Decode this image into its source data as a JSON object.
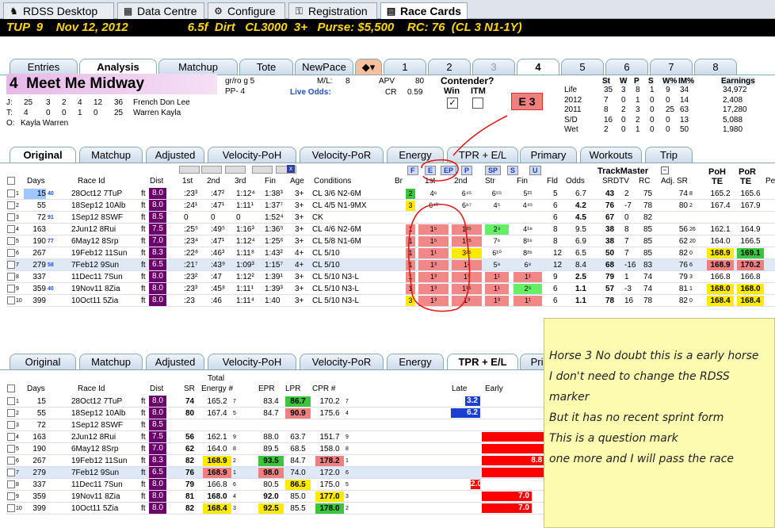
{
  "app_tabs": [
    {
      "label": "RDSS Desktop",
      "icon": "horse-icon"
    },
    {
      "label": "Data Centre",
      "icon": "grid-icon"
    },
    {
      "label": "Configure",
      "icon": "gear-icon"
    },
    {
      "label": "Registration",
      "icon": "key-icon"
    },
    {
      "label": "Race Cards",
      "icon": "card-icon"
    }
  ],
  "race_header": "TUP  9    Nov 12, 2012                  6.5f  Dirt   CL3000  3+   Purse: $5,500    RC: 76  (CL 3 N1-1Y)",
  "horse_tabs": [
    "Entries",
    "Analysis",
    "Matchup",
    "Tote",
    "NewPace",
    "1",
    "2",
    "3",
    "4",
    "5",
    "6",
    "7",
    "8"
  ],
  "horse": {
    "number": "4",
    "name": "Meet Me Midway",
    "sex": "gr/ro g 5",
    "pp": "PP- 4",
    "ml_label": "M/L:",
    "ml": "8",
    "apv_label": "APV",
    "apv": "80",
    "cr_label": "CR",
    "cr": "0.59",
    "live_odds": "Live Odds:",
    "contender": "Contender?",
    "win": "Win",
    "itm": "ITM",
    "pace_badge": "E 3"
  },
  "connections": [
    {
      "code": "J:",
      "stats": [
        "25",
        "3",
        "2",
        "4",
        "12",
        "36"
      ],
      "name": "French Don Lee"
    },
    {
      "code": "T:",
      "stats": [
        "4",
        "0",
        "0",
        "1",
        "0",
        "25"
      ],
      "name": "Warren Kayla"
    },
    {
      "code": "O:",
      "stats": [],
      "name": "Kayla Warren"
    }
  ],
  "record": {
    "headers": [
      "St",
      "W",
      "P",
      "S",
      "W%",
      "IM%",
      "Earnings"
    ],
    "rows": [
      [
        "Life",
        "35",
        "3",
        "8",
        "1",
        "9",
        "34",
        "34,972"
      ],
      [
        "2012",
        "7",
        "0",
        "1",
        "0",
        "0",
        "14",
        "2,408"
      ],
      [
        "2011",
        "8",
        "2",
        "3",
        "0",
        "25",
        "63",
        "17,280"
      ],
      [
        "S/D",
        "16",
        "0",
        "2",
        "0",
        "0",
        "13",
        "5,088"
      ],
      [
        "Wet",
        "2",
        "0",
        "1",
        "0",
        "0",
        "50",
        "1,980"
      ]
    ]
  },
  "view_tabs": [
    "Original",
    "Matchup",
    "Adjusted",
    "Velocity-PoH",
    "Velocity-PoR",
    "Energy",
    "TPR + E/L",
    "Primary",
    "Workouts",
    "Trip"
  ],
  "pace_buttons": [
    "F",
    "E",
    "EP",
    "P",
    "SP",
    "S",
    "U"
  ],
  "trackmaster": "TrackMaster",
  "top_headers": {
    "days": "Days",
    "race_id": "Race Id",
    "dist": "Dist",
    "c1": "1st",
    "c2": "2nd",
    "c3": "3rd",
    "fin": "Fin",
    "age": "Age",
    "cond": "Conditions",
    "br": "Br",
    "f1": "1st",
    "f2": "2nd",
    "str": "Str",
    "ffin": "Fin",
    "fld": "Fld",
    "odds": "Odds",
    "srdtv": "SRDTV",
    "rc": "RC",
    "adjsr": "Adj. SR",
    "poh": "PoH",
    "por": "PoR",
    "pe": "Pe",
    "te1": "TE",
    "te2": "TE"
  },
  "past": [
    {
      "n": "1",
      "days": "15",
      "d2": "40",
      "race": "28Oct12 7TuP",
      "s": "ft",
      "dist": "8.0",
      "c1": ":23³",
      "c2": ":47²",
      "c3": "1:12⁴",
      "fin": "1:38³",
      "age": "3+",
      "cond": "CL 3/6 N2-6M",
      "br": "2",
      "p1": "4⁶",
      "p2": "6⁴⁵",
      "str": "6⁵⁵",
      "pf": "5²¹",
      "fld": "5",
      "odds": "6.7",
      "sr": "43",
      "dtv": "2",
      "rc": "75",
      "adj": "74",
      "adjs": "8",
      "poh": "165.2",
      "por": "165.6"
    },
    {
      "n": "2",
      "days": "55",
      "d2": "",
      "race": "18Sep12 10Alb",
      "s": "ft",
      "dist": "8.0",
      "c1": ":24¹",
      "c2": ":47¹",
      "c3": "1:11¹",
      "fin": "1:37⁷",
      "age": "3+",
      "cond": "CL 4/5 N1-9MX",
      "br": "3",
      "p1": "6⁴³",
      "p2": "6⁶⁷",
      "str": "4⁵",
      "pf": "4⁴⁵",
      "fld": "6",
      "odds": "4.2",
      "sr": "76",
      "dtv": "-7",
      "rc": "78",
      "adj": "80",
      "adjs": "2",
      "poh": "167.4",
      "por": "167.9"
    },
    {
      "n": "3",
      "days": "72",
      "d2": "91",
      "race": "1Sep12 8SWF",
      "s": "ft",
      "dist": "8.5",
      "c1": "0",
      "c2": "0",
      "c3": "0",
      "fin": "1:52⁴",
      "age": "3+",
      "cond": "CK",
      "br": "",
      "p1": "",
      "p2": "",
      "str": "",
      "pf": "",
      "fld": "6",
      "odds": "4.5",
      "sr": "67",
      "dtv": "0",
      "rc": "82",
      "adj": "",
      "adjs": "",
      "poh": "",
      "por": ""
    },
    {
      "n": "4",
      "days": "163",
      "d2": "",
      "race": "2Jun12 8Rui",
      "s": "ft",
      "dist": "7.5",
      "c1": ":25⁵",
      "c2": ":49⁵",
      "c3": "1:16³",
      "fin": "1:36⁵",
      "age": "3+",
      "cond": "CL 4/6 N2-6M",
      "br": "1",
      "p1": "1⁵",
      "p2": "1²⁵",
      "str": "2⁴",
      "pf": "4¹⁸",
      "fld": "8",
      "odds": "9.5",
      "sr": "38",
      "dtv": "8",
      "rc": "85",
      "adj": "56",
      "adjs": "26",
      "poh": "162.1",
      "por": "164.9"
    },
    {
      "n": "5",
      "days": "190",
      "d2": "77",
      "race": "6May12 8Srp",
      "s": "ft",
      "dist": "7.0",
      "c1": ":23⁴",
      "c2": ":47¹",
      "c3": "1:12⁴",
      "fin": "1:25⁶",
      "age": "3+",
      "cond": "CL 5/8 N1-6M",
      "br": "1",
      "p1": "1⁵",
      "p2": "1²⁵",
      "str": "7⁶",
      "pf": "8¹⁶",
      "fld": "8",
      "odds": "6.9",
      "sr": "38",
      "dtv": "7",
      "rc": "85",
      "adj": "62",
      "adjs": "20",
      "poh": "164.0",
      "por": "166.5"
    },
    {
      "n": "6",
      "days": "267",
      "d2": "",
      "race": "19Feb12 11Sun",
      "s": "ft",
      "dist": "8.3",
      "c1": ":22⁸",
      "c2": ":46³",
      "c3": "1:11⁸",
      "fin": "1:43²",
      "age": "4+",
      "cond": "CL 5/10",
      "br": "1",
      "p1": "1¹",
      "p2": "3²⁵",
      "str": "6¹⁰",
      "pf": "8²⁶",
      "fld": "12",
      "odds": "6.5",
      "sr": "50",
      "dtv": "7",
      "rc": "85",
      "adj": "82",
      "adjs": "0",
      "poh": "168.9",
      "por": "169.1"
    },
    {
      "n": "7",
      "days": "279",
      "d2": "58",
      "race": "7Feb12 9Sun",
      "s": "ft",
      "dist": "6.5",
      "c1": ":21⁷",
      "c2": ":43⁹",
      "c3": "1:09³",
      "fin": "1:15⁷",
      "age": "4+",
      "cond": "CL 5/10",
      "br": "1",
      "p1": "1³",
      "p2": "1²",
      "str": "5⁸",
      "pf": "6⁸",
      "fld": "12",
      "odds": "8.4",
      "sr": "68",
      "dtv": "-16",
      "rc": "83",
      "adj": "76",
      "adjs": "6",
      "poh": "168.9",
      "por": "170.2"
    },
    {
      "n": "8",
      "days": "337",
      "d2": "",
      "race": "11Dec11 7Sun",
      "s": "ft",
      "dist": "8.0",
      "c1": ":23²",
      "c2": ":47",
      "c3": "1:12²",
      "fin": "1:39¹",
      "age": "3+",
      "cond": "CL 5/10 N3-L",
      "br": "1",
      "p1": "1³",
      "p2": "1³",
      "str": "1¹",
      "pf": "1¹",
      "fld": "9",
      "odds": "2.5",
      "sr": "79",
      "dtv": "1",
      "rc": "74",
      "adj": "79",
      "adjs": "3",
      "poh": "166.8",
      "por": "166.8"
    },
    {
      "n": "9",
      "days": "359",
      "d2": "40",
      "race": "19Nov11 8Zia",
      "s": "ft",
      "dist": "8.0",
      "c1": ":23³",
      "c2": ":45⁸",
      "c3": "1:11¹",
      "fin": "1:39³",
      "age": "3+",
      "cond": "CL 5/10 N3-L",
      "br": "1",
      "p1": "1³",
      "p2": "1¹⁵",
      "str": "1¹",
      "pf": "2⁵",
      "fld": "6",
      "odds": "1.1",
      "sr": "57",
      "dtv": "-3",
      "rc": "74",
      "adj": "81",
      "adjs": "1",
      "poh": "168.0",
      "por": "168.0"
    },
    {
      "n": "10",
      "days": "399",
      "d2": "",
      "race": "10Oct11 5Zia",
      "s": "ft",
      "dist": "8.0",
      "c1": ":23",
      "c2": ":46",
      "c3": "1:11⁴",
      "fin": "1:40",
      "age": "3+",
      "cond": "CL 5/10 N3-L",
      "br": "3",
      "p1": "1³",
      "p2": "1³",
      "str": "1³",
      "pf": "1¹",
      "fld": "6",
      "odds": "1.1",
      "sr": "78",
      "dtv": "16",
      "rc": "78",
      "adj": "82",
      "adjs": "0",
      "poh": "168.4",
      "por": "168.4"
    }
  ],
  "bottom_headers": {
    "days": "Days",
    "race_id": "Race Id",
    "dist": "Dist",
    "sr": "SR",
    "total": "Total",
    "energy": "Energy #",
    "epr": "EPR",
    "lpr": "LPR",
    "cpr": "CPR #",
    "late": "Late",
    "early": "Early"
  },
  "energy": [
    {
      "n": "1",
      "days": "15",
      "race": "28Oct12 7TuP",
      "s": "ft",
      "dist": "8.0",
      "sr": "74",
      "en": "165.2",
      "enr": "7",
      "epr": "83.4",
      "lpr": "86.7",
      "cpr": "170.2",
      "cprr": "7",
      "late": "3.2",
      "early": ""
    },
    {
      "n": "2",
      "days": "55",
      "race": "18Sep12 10Alb",
      "s": "ft",
      "dist": "8.0",
      "sr": "80",
      "en": "167.4",
      "enr": "5",
      "epr": "84.7",
      "lpr": "90.9",
      "cpr": "175.6",
      "cprr": "4",
      "late": "6.2",
      "early": ""
    },
    {
      "n": "3",
      "days": "72",
      "race": "1Sep12 8SWF",
      "s": "ft",
      "dist": "8.5",
      "sr": "",
      "en": "",
      "enr": "",
      "epr": "",
      "lpr": "",
      "cpr": "",
      "cprr": "",
      "late": "",
      "early": ""
    },
    {
      "n": "4",
      "days": "163",
      "race": "2Jun12 8Rui",
      "s": "ft",
      "dist": "7.5",
      "sr": "56",
      "en": "162.1",
      "enr": "9",
      "epr": "88.0",
      "lpr": "63.7",
      "cpr": "151.7",
      "cprr": "9",
      "late": "",
      "early": ""
    },
    {
      "n": "5",
      "days": "190",
      "race": "6May12 8Srp",
      "s": "ft",
      "dist": "7.0",
      "sr": "62",
      "en": "164.0",
      "enr": "8",
      "epr": "89.5",
      "lpr": "68.5",
      "cpr": "158.0",
      "cprr": "8",
      "late": "",
      "early": ""
    },
    {
      "n": "6",
      "days": "267",
      "race": "19Feb12 11Sun",
      "s": "ft",
      "dist": "8.3",
      "sr": "82",
      "en": "168.9",
      "enr": "2",
      "epr": "93.5",
      "lpr": "84.7",
      "cpr": "178.2",
      "cprr": "1",
      "late": "",
      "early": "8.8"
    },
    {
      "n": "7",
      "days": "279",
      "race": "7Feb12 9Sun",
      "s": "ft",
      "dist": "6.5",
      "sr": "76",
      "en": "168.9",
      "enr": "1",
      "epr": "98.0",
      "lpr": "74.0",
      "cpr": "172.0",
      "cprr": "6",
      "late": "",
      "early": ""
    },
    {
      "n": "8",
      "days": "337",
      "race": "11Dec11 7Sun",
      "s": "ft",
      "dist": "8.0",
      "sr": "79",
      "en": "166.8",
      "enr": "6",
      "epr": "80.5",
      "lpr": "86.5",
      "cpr": "175.0",
      "cprr": "5",
      "late": "2.0",
      "early": ""
    },
    {
      "n": "9",
      "days": "359",
      "race": "19Nov11 8Zia",
      "s": "ft",
      "dist": "8.0",
      "sr": "81",
      "en": "168.0",
      "enr": "4",
      "epr": "92.0",
      "lpr": "85.0",
      "cpr": "177.0",
      "cprr": "3",
      "late": "",
      "early": "7.0"
    },
    {
      "n": "10",
      "days": "399",
      "race": "10Oct11 5Zia",
      "s": "ft",
      "dist": "8.0",
      "sr": "82",
      "en": "168.4",
      "enr": "3",
      "epr": "92.5",
      "lpr": "85.5",
      "cpr": "178.0",
      "cprr": "2",
      "late": "",
      "early": "7.0"
    }
  ],
  "note_lines": [
    "Horse 3 No doubt this is a early horse",
    "I don't need to change the RDSS",
    "marker",
    "But it has no recent sprint form",
    "This is a question mark",
    "one more and I will pass the race"
  ]
}
